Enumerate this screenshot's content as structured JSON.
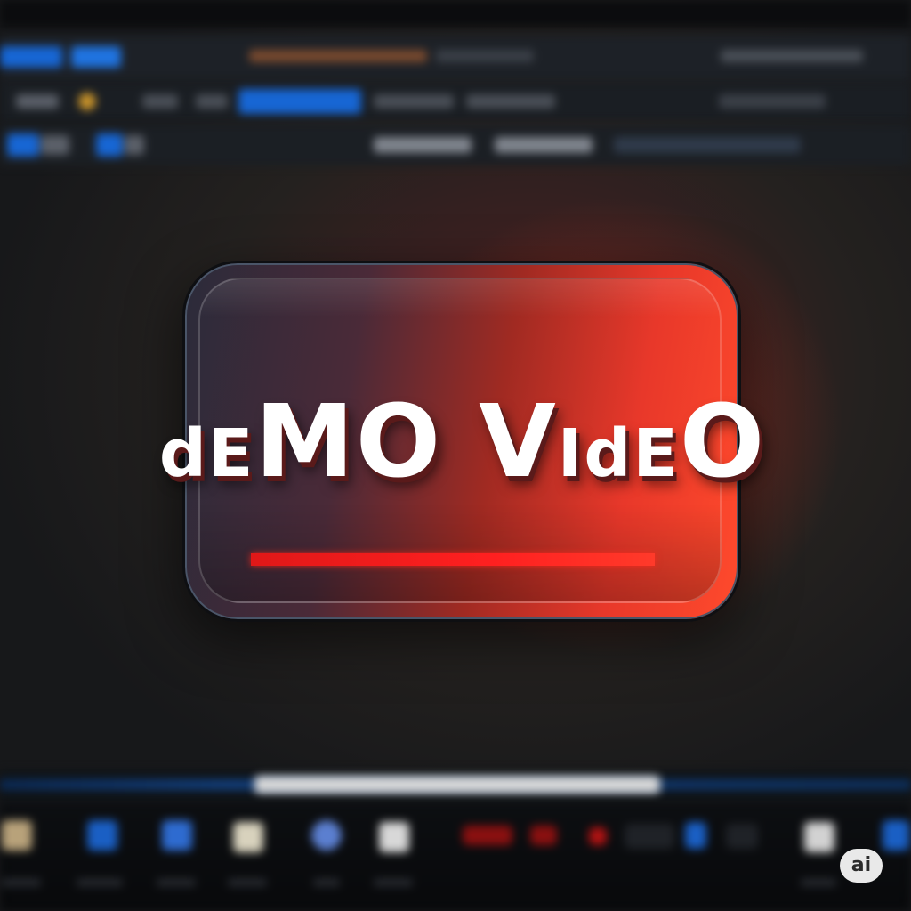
{
  "panel": {
    "title_parts": [
      "d",
      "E",
      "MO",
      " ",
      "V",
      "Id",
      "E",
      "O"
    ],
    "title_full": "dEMO VIdEO"
  },
  "badge": {
    "label": "ai"
  },
  "colors": {
    "accent_red": "#ff3a2a",
    "highlight_blue": "#1766d4",
    "background_dark": "#17181a"
  },
  "icons": {
    "dock": [
      "folder-icon",
      "document-icon",
      "document-icon",
      "image-icon",
      "app-icon",
      "image-icon",
      "record-icon",
      "record-icon",
      "stop-icon",
      "control-icon",
      "app-icon",
      "image-icon",
      "app-icon"
    ]
  },
  "timeline": {
    "progress": 0.5
  }
}
